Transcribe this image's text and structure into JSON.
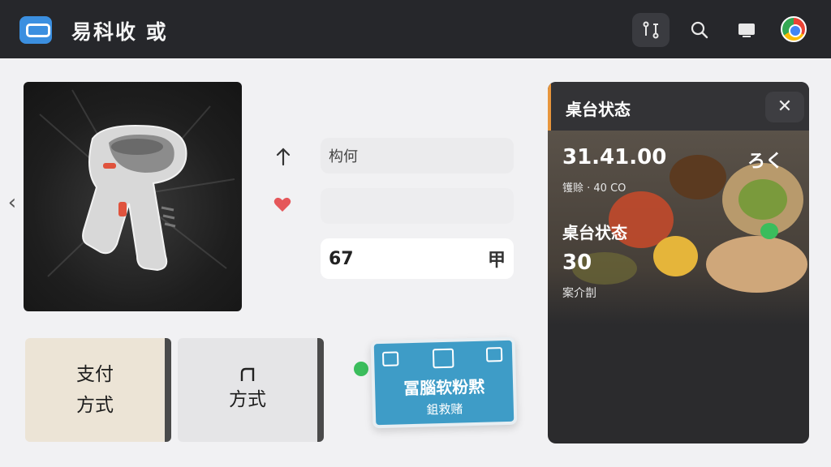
{
  "header": {
    "app_title": "易科收 或",
    "actions": [
      {
        "icon": "route-icon",
        "active": true
      },
      {
        "icon": "search-icon",
        "active": false
      },
      {
        "icon": "display-icon",
        "active": false
      },
      {
        "icon": "profile-avatar",
        "active": false
      }
    ]
  },
  "product": {
    "image": "handheld-barcode-scanner"
  },
  "fields": {
    "field1_label": "构何",
    "field1_ghost": "",
    "field3_left": "67",
    "field3_right": "甲"
  },
  "payment": {
    "card1_line1": "支付",
    "card1_line2": "方式",
    "card2_line2": "方式"
  },
  "promo": {
    "title": "冨腦软粉黙",
    "subtitle": "鉏救赌"
  },
  "panel": {
    "title": "桌台状态",
    "value": "31.41.00",
    "value_icon": "ろく",
    "meta": "镬赊 · 40 CO",
    "subtitle": "桌台状态",
    "count": "30",
    "count_label": "案介剒"
  },
  "colors": {
    "topbar": "#26272b",
    "accent_blue": "#3b8fe0",
    "promo_blue": "#3e9cc7",
    "status_green": "#3bbd5c",
    "panel_accent": "#e8963c",
    "heart": "#e5575a"
  }
}
